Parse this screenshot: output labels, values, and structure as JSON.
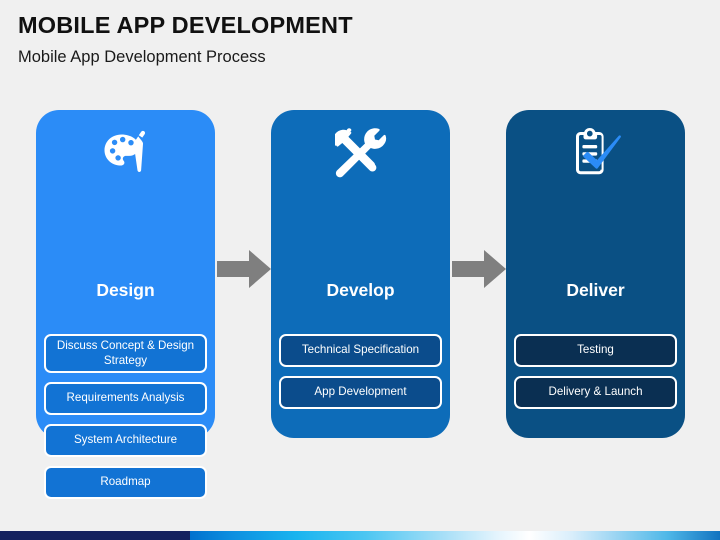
{
  "header": {
    "title": "MOBILE APP DEVELOPMENT",
    "subtitle": "Mobile App Development Process"
  },
  "diagram": {
    "type": "process-flow",
    "stages": [
      {
        "heading": "Design",
        "icon": "palette-brush-icon",
        "card_color": "#2b8cf7",
        "item_color": "#1273d4",
        "items": [
          "Discuss Concept & Design Strategy",
          "Requirements Analysis",
          "System Architecture",
          "Roadmap"
        ]
      },
      {
        "heading": "Develop",
        "icon": "wrench-screwdriver-icon",
        "card_color": "#0d6cb9",
        "item_color": "#0b4c8c",
        "items": [
          "Technical Specification",
          "App Development"
        ]
      },
      {
        "heading": "Deliver",
        "icon": "clipboard-check-icon",
        "card_color": "#0a5084",
        "item_color": "#0a2f52",
        "items": [
          "Testing",
          "Delivery & Launch"
        ]
      }
    ],
    "arrows": [
      {
        "name": "arrow-design-to-develop",
        "color": "#7f7f7f"
      },
      {
        "name": "arrow-develop-to-deliver",
        "color": "#7f7f7f"
      }
    ]
  },
  "footer": {
    "bar_navy_color": "#14215e",
    "bar_gradient_start": "#0071ce",
    "bar_gradient_end": "#1273c0"
  }
}
